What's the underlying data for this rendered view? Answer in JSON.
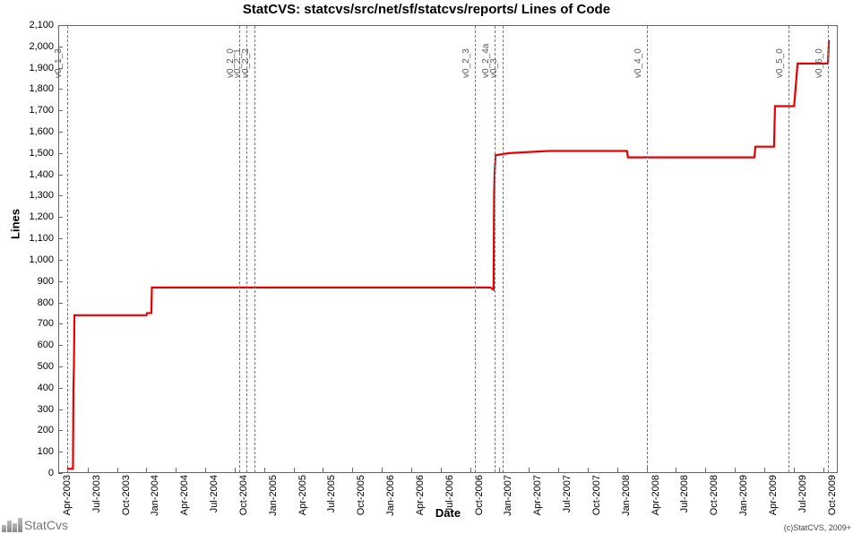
{
  "chart_data": {
    "type": "line",
    "title": "StatCVS: statcvs/src/net/sf/statcvs/reports/ Lines of Code",
    "xlabel": "Date",
    "ylabel": "Lines",
    "ylim": [
      0,
      2100
    ],
    "ytick_step": 100,
    "x_categories": [
      "Apr-2003",
      "Jul-2003",
      "Oct-2003",
      "Jan-2004",
      "Apr-2004",
      "Jul-2004",
      "Oct-2004",
      "Jan-2005",
      "Apr-2005",
      "Jul-2005",
      "Oct-2005",
      "Jan-2006",
      "Apr-2006",
      "Jul-2006",
      "Oct-2006",
      "Jan-2007",
      "Apr-2007",
      "Jul-2007",
      "Oct-2007",
      "Jan-2008",
      "Apr-2008",
      "Jul-2008",
      "Oct-2008",
      "Jan-2009",
      "Apr-2009",
      "Jul-2009",
      "Oct-2009"
    ],
    "x_range_months": [
      0,
      79.5
    ],
    "series": [
      {
        "name": "Lines of Code",
        "color": "#e60000",
        "points": [
          [
            0.9,
            20
          ],
          [
            1.5,
            20
          ],
          [
            1.55,
            400
          ],
          [
            1.6,
            500
          ],
          [
            1.65,
            740
          ],
          [
            9.0,
            740
          ],
          [
            9.05,
            750
          ],
          [
            9.5,
            750
          ],
          [
            9.55,
            870
          ],
          [
            44.0,
            870
          ],
          [
            44.05,
            870
          ],
          [
            44.4,
            860
          ],
          [
            44.45,
            1300
          ],
          [
            44.5,
            1400
          ],
          [
            44.6,
            1490
          ],
          [
            46.0,
            1500
          ],
          [
            50.0,
            1510
          ],
          [
            58.0,
            1510
          ],
          [
            58.1,
            1480
          ],
          [
            71.0,
            1480
          ],
          [
            71.1,
            1530
          ],
          [
            73.0,
            1530
          ],
          [
            73.1,
            1720
          ],
          [
            75.0,
            1720
          ],
          [
            75.05,
            1720
          ],
          [
            75.4,
            1920
          ],
          [
            78.5,
            1920
          ],
          [
            78.6,
            2030
          ]
        ]
      }
    ],
    "markers": [
      {
        "label": "v0_1_3",
        "month": 0.9
      },
      {
        "label": "v0_2_0",
        "month": 18.5
      },
      {
        "label": "v0_2_1",
        "month": 19.2
      },
      {
        "label": "v0_2_2",
        "month": 20.0
      },
      {
        "label": "v0_2_3",
        "month": 42.5
      },
      {
        "label": "v0_2_4a",
        "month": 44.5
      },
      {
        "label": "v0_3",
        "month": 45.3
      },
      {
        "label": "v0_4_0",
        "month": 60.0
      },
      {
        "label": "v0_5_0",
        "month": 74.5
      },
      {
        "label": "v0_6_0",
        "month": 78.5
      }
    ]
  },
  "footer": {
    "logo_text": "StatCvs",
    "copyright": "(c)StatCVS, 2009+"
  }
}
